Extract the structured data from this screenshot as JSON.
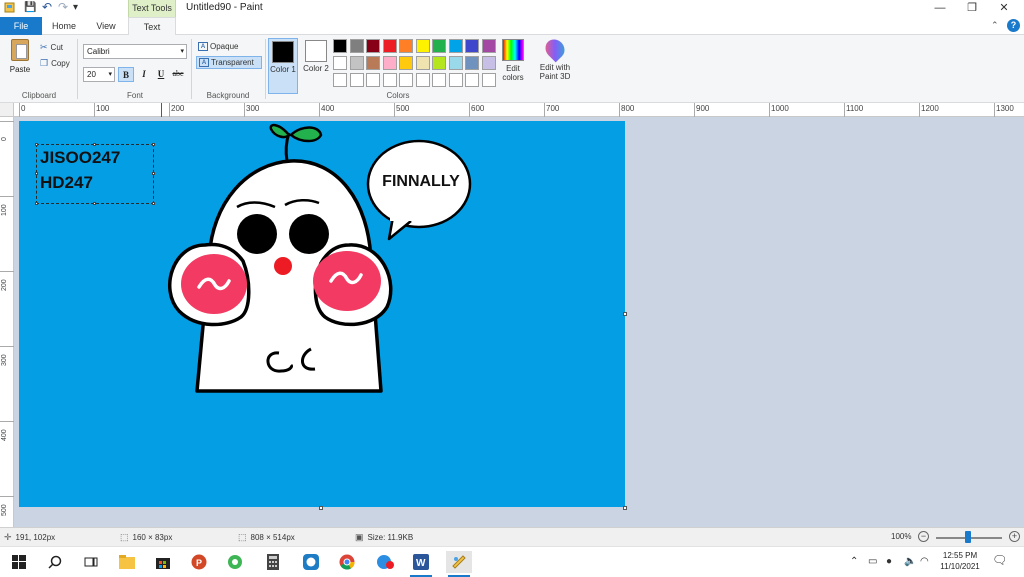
{
  "window": {
    "title": "Untitled90 - Paint",
    "context_tab": "Text Tools",
    "minimize": "—",
    "restore": "❐",
    "close": "✕"
  },
  "quick_access": {
    "save": "💾",
    "undo": "↶",
    "redo": "↷",
    "customize": "▾"
  },
  "tabs": {
    "file": "File",
    "home": "Home",
    "view": "View",
    "text": "Text"
  },
  "help": {
    "collapse": "⌃",
    "help": "?"
  },
  "clipboard": {
    "paste": "Paste",
    "cut": "Cut",
    "copy": "Copy",
    "group": "Clipboard"
  },
  "font": {
    "name": "Calibri",
    "size": "20",
    "bold": "B",
    "italic": "I",
    "underline": "U",
    "strikethrough": "abc",
    "group": "Font",
    "dropdown": "▾"
  },
  "background": {
    "opaque": "Opaque",
    "transparent": "Transparent",
    "group": "Background"
  },
  "colors": {
    "color1_label": "Color 1",
    "color2_label": "Color 2",
    "color1": "#000000",
    "color2": "#ffffff",
    "edit_colors": "Edit colors",
    "paint3d": "Edit with Paint 3D",
    "group": "Colors",
    "palette_row1": [
      "#000000",
      "#7f7f7f",
      "#880015",
      "#ed1c24",
      "#ff7f27",
      "#fff200",
      "#22b14c",
      "#00a2e8",
      "#3f48cc",
      "#a349a4"
    ],
    "palette_row2": [
      "#ffffff",
      "#c3c3c3",
      "#b97a57",
      "#ffaec9",
      "#ffc90e",
      "#efe4b0",
      "#b5e61d",
      "#99d9ea",
      "#7092be",
      "#c8bfe7"
    ],
    "palette_row3": [
      "#ffffff",
      "#ffffff",
      "#ffffff",
      "#ffffff",
      "#ffffff",
      "#ffffff",
      "#ffffff",
      "#ffffff",
      "#ffffff",
      "#ffffff"
    ]
  },
  "ruler": {
    "h_labels": [
      "0",
      "100",
      "200",
      "300",
      "400",
      "500",
      "600",
      "700",
      "800",
      "900",
      "1000",
      "1100",
      "1200",
      "1300"
    ],
    "v_labels": [
      "0",
      "100",
      "200",
      "300",
      "400",
      "500"
    ]
  },
  "canvas": {
    "background": "#049ee5",
    "text_line1": "JISOO247",
    "text_line2": "HD247",
    "bubble_text": "FINNALLY"
  },
  "status": {
    "cursor_pos": "191, 102px",
    "selection_size": "160 × 83px",
    "image_size": "808 × 514px",
    "file_size": "Size: 11.9KB",
    "zoom": "100%",
    "zoom_out": "−",
    "zoom_in": "+"
  },
  "taskbar": {
    "time": "12:55 PM",
    "date": "11/10/2021"
  }
}
